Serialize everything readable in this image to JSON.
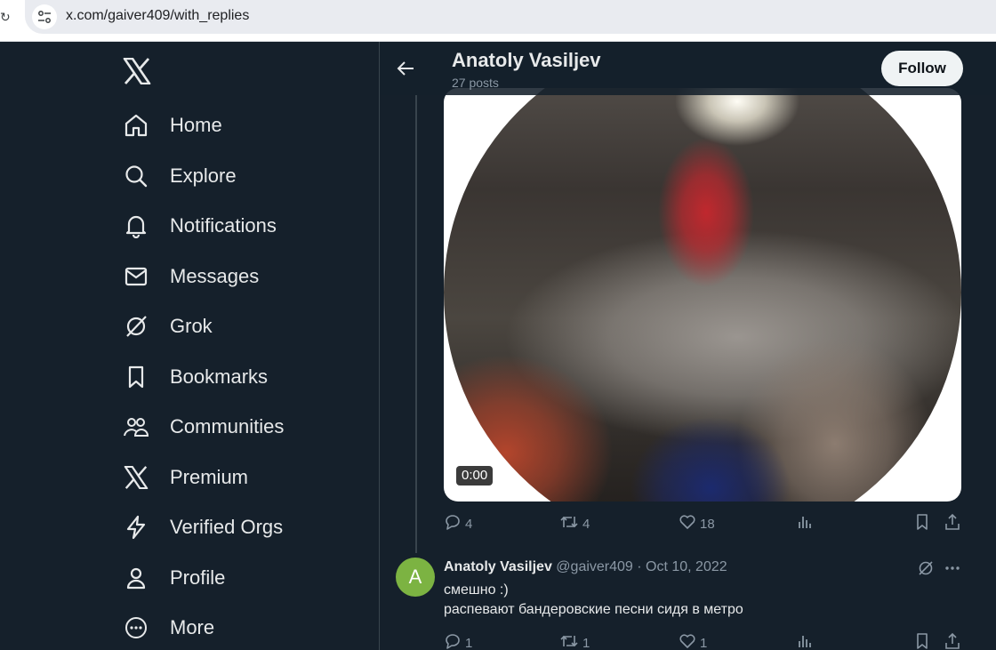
{
  "browser": {
    "url": "x.com/gaiver409/with_replies"
  },
  "sidebar": {
    "items": [
      {
        "label": "Home",
        "icon": "home-icon"
      },
      {
        "label": "Explore",
        "icon": "search-icon"
      },
      {
        "label": "Notifications",
        "icon": "bell-icon"
      },
      {
        "label": "Messages",
        "icon": "envelope-icon"
      },
      {
        "label": "Grok",
        "icon": "grok-icon"
      },
      {
        "label": "Bookmarks",
        "icon": "bookmark-icon"
      },
      {
        "label": "Communities",
        "icon": "people-icon"
      },
      {
        "label": "Premium",
        "icon": "x-logo-icon"
      },
      {
        "label": "Verified Orgs",
        "icon": "lightning-icon"
      },
      {
        "label": "Profile",
        "icon": "person-icon"
      },
      {
        "label": "More",
        "icon": "more-circle-icon"
      }
    ]
  },
  "header": {
    "name": "Anatoly Vasiljev",
    "post_count": "27 posts",
    "follow_label": "Follow"
  },
  "video": {
    "timestamp": "0:00"
  },
  "post1_actions": {
    "replies": "4",
    "reposts": "4",
    "likes": "18"
  },
  "tweet": {
    "avatar_letter": "A",
    "name": "Anatoly Vasiljev",
    "handle_date": "@gaiver409 · Oct 10, 2022",
    "line1": "смешно :)",
    "line2": "распевают бандеровские песни сидя в метро",
    "replies": "1",
    "reposts": "1",
    "likes": "1"
  },
  "colors": {
    "background": "#15202b",
    "text": "#e7e9ea",
    "muted": "#8b98a5",
    "avatar": "#7cb342"
  }
}
